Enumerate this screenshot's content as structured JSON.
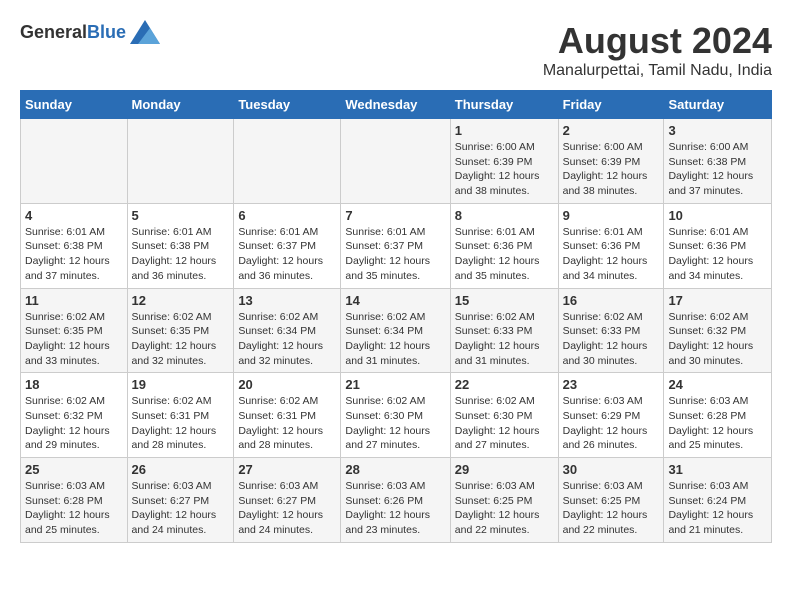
{
  "header": {
    "logo_general": "General",
    "logo_blue": "Blue",
    "title": "August 2024",
    "subtitle": "Manalurpettai, Tamil Nadu, India"
  },
  "days_of_week": [
    "Sunday",
    "Monday",
    "Tuesday",
    "Wednesday",
    "Thursday",
    "Friday",
    "Saturday"
  ],
  "weeks": [
    [
      {
        "day": "",
        "info": ""
      },
      {
        "day": "",
        "info": ""
      },
      {
        "day": "",
        "info": ""
      },
      {
        "day": "",
        "info": ""
      },
      {
        "day": "1",
        "info": "Sunrise: 6:00 AM\nSunset: 6:39 PM\nDaylight: 12 hours\nand 38 minutes."
      },
      {
        "day": "2",
        "info": "Sunrise: 6:00 AM\nSunset: 6:39 PM\nDaylight: 12 hours\nand 38 minutes."
      },
      {
        "day": "3",
        "info": "Sunrise: 6:00 AM\nSunset: 6:38 PM\nDaylight: 12 hours\nand 37 minutes."
      }
    ],
    [
      {
        "day": "4",
        "info": "Sunrise: 6:01 AM\nSunset: 6:38 PM\nDaylight: 12 hours\nand 37 minutes."
      },
      {
        "day": "5",
        "info": "Sunrise: 6:01 AM\nSunset: 6:38 PM\nDaylight: 12 hours\nand 36 minutes."
      },
      {
        "day": "6",
        "info": "Sunrise: 6:01 AM\nSunset: 6:37 PM\nDaylight: 12 hours\nand 36 minutes."
      },
      {
        "day": "7",
        "info": "Sunrise: 6:01 AM\nSunset: 6:37 PM\nDaylight: 12 hours\nand 35 minutes."
      },
      {
        "day": "8",
        "info": "Sunrise: 6:01 AM\nSunset: 6:36 PM\nDaylight: 12 hours\nand 35 minutes."
      },
      {
        "day": "9",
        "info": "Sunrise: 6:01 AM\nSunset: 6:36 PM\nDaylight: 12 hours\nand 34 minutes."
      },
      {
        "day": "10",
        "info": "Sunrise: 6:01 AM\nSunset: 6:36 PM\nDaylight: 12 hours\nand 34 minutes."
      }
    ],
    [
      {
        "day": "11",
        "info": "Sunrise: 6:02 AM\nSunset: 6:35 PM\nDaylight: 12 hours\nand 33 minutes."
      },
      {
        "day": "12",
        "info": "Sunrise: 6:02 AM\nSunset: 6:35 PM\nDaylight: 12 hours\nand 32 minutes."
      },
      {
        "day": "13",
        "info": "Sunrise: 6:02 AM\nSunset: 6:34 PM\nDaylight: 12 hours\nand 32 minutes."
      },
      {
        "day": "14",
        "info": "Sunrise: 6:02 AM\nSunset: 6:34 PM\nDaylight: 12 hours\nand 31 minutes."
      },
      {
        "day": "15",
        "info": "Sunrise: 6:02 AM\nSunset: 6:33 PM\nDaylight: 12 hours\nand 31 minutes."
      },
      {
        "day": "16",
        "info": "Sunrise: 6:02 AM\nSunset: 6:33 PM\nDaylight: 12 hours\nand 30 minutes."
      },
      {
        "day": "17",
        "info": "Sunrise: 6:02 AM\nSunset: 6:32 PM\nDaylight: 12 hours\nand 30 minutes."
      }
    ],
    [
      {
        "day": "18",
        "info": "Sunrise: 6:02 AM\nSunset: 6:32 PM\nDaylight: 12 hours\nand 29 minutes."
      },
      {
        "day": "19",
        "info": "Sunrise: 6:02 AM\nSunset: 6:31 PM\nDaylight: 12 hours\nand 28 minutes."
      },
      {
        "day": "20",
        "info": "Sunrise: 6:02 AM\nSunset: 6:31 PM\nDaylight: 12 hours\nand 28 minutes."
      },
      {
        "day": "21",
        "info": "Sunrise: 6:02 AM\nSunset: 6:30 PM\nDaylight: 12 hours\nand 27 minutes."
      },
      {
        "day": "22",
        "info": "Sunrise: 6:02 AM\nSunset: 6:30 PM\nDaylight: 12 hours\nand 27 minutes."
      },
      {
        "day": "23",
        "info": "Sunrise: 6:03 AM\nSunset: 6:29 PM\nDaylight: 12 hours\nand 26 minutes."
      },
      {
        "day": "24",
        "info": "Sunrise: 6:03 AM\nSunset: 6:28 PM\nDaylight: 12 hours\nand 25 minutes."
      }
    ],
    [
      {
        "day": "25",
        "info": "Sunrise: 6:03 AM\nSunset: 6:28 PM\nDaylight: 12 hours\nand 25 minutes."
      },
      {
        "day": "26",
        "info": "Sunrise: 6:03 AM\nSunset: 6:27 PM\nDaylight: 12 hours\nand 24 minutes."
      },
      {
        "day": "27",
        "info": "Sunrise: 6:03 AM\nSunset: 6:27 PM\nDaylight: 12 hours\nand 24 minutes."
      },
      {
        "day": "28",
        "info": "Sunrise: 6:03 AM\nSunset: 6:26 PM\nDaylight: 12 hours\nand 23 minutes."
      },
      {
        "day": "29",
        "info": "Sunrise: 6:03 AM\nSunset: 6:25 PM\nDaylight: 12 hours\nand 22 minutes."
      },
      {
        "day": "30",
        "info": "Sunrise: 6:03 AM\nSunset: 6:25 PM\nDaylight: 12 hours\nand 22 minutes."
      },
      {
        "day": "31",
        "info": "Sunrise: 6:03 AM\nSunset: 6:24 PM\nDaylight: 12 hours\nand 21 minutes."
      }
    ]
  ]
}
